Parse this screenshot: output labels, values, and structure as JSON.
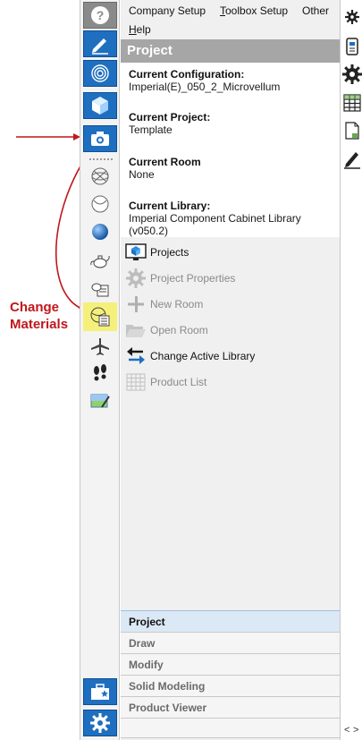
{
  "annotation": {
    "label": "Change Materials",
    "color": "#c0171b",
    "highlight_color": "#f5f07a"
  },
  "menu": {
    "items": [
      {
        "label": "Company Setup"
      },
      {
        "label": "Toolbox Setup"
      },
      {
        "label": "Other"
      },
      {
        "label": "Help"
      }
    ]
  },
  "panel": {
    "title": "Project",
    "info": [
      {
        "title": "Current Configuration:",
        "value": "Imperial(E)_050_2_Microvellum"
      },
      {
        "title": "Current Project:",
        "value": "Template"
      },
      {
        "title": "Current Room",
        "value": "None"
      },
      {
        "title": "Current Library:",
        "value": "Imperial Component Cabinet Library (v050.2)"
      }
    ],
    "actions": [
      {
        "label": "Projects",
        "icon": "projects-monitor-icon",
        "enabled": true
      },
      {
        "label": "Project Properties",
        "icon": "gear-icon",
        "enabled": false
      },
      {
        "label": "New Room",
        "icon": "plus-icon",
        "enabled": false
      },
      {
        "label": "Open Room",
        "icon": "folder-open-icon",
        "enabled": false
      },
      {
        "label": "Change Active Library",
        "icon": "swap-arrows-icon",
        "enabled": true
      },
      {
        "label": "Product List",
        "icon": "grid-list-icon",
        "enabled": false
      }
    ]
  },
  "tabs": [
    {
      "label": "Project",
      "active": true
    },
    {
      "label": "Draw",
      "active": false
    },
    {
      "label": "Modify",
      "active": false
    },
    {
      "label": "Solid Modeling",
      "active": false
    },
    {
      "label": "Product Viewer",
      "active": false
    }
  ],
  "left_toolbar": [
    "help-icon",
    "pencil-edit-icon",
    "fingerprint-icon",
    "cube-icon",
    "camera-icon",
    "wireframe-sphere-icon",
    "hidden-sphere-icon",
    "shaded-sphere-icon",
    "teapot-icon",
    "material-list-icon",
    "change-materials-icon",
    "airplane-icon",
    "footprints-icon",
    "image-edit-icon",
    "toolbox-star-icon",
    "settings-gear-icon"
  ],
  "right_toolbar": [
    "gear-small-icon",
    "document-icon",
    "gear-large-icon",
    "table-icon",
    "page-icon",
    "pen-icon"
  ],
  "colors": {
    "accent_blue": "#1e6fc0",
    "header_gray": "#a6a6a6",
    "active_tab": "#dbe8f5"
  }
}
